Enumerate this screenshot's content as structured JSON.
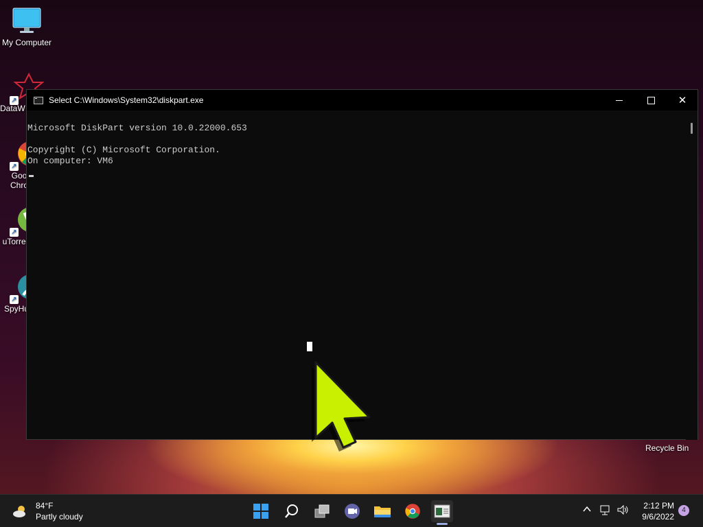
{
  "desktop": {
    "icons": [
      {
        "label": "My Computer"
      },
      {
        "label": "DataW"
      },
      {
        "label": "Goo Chro"
      },
      {
        "label": "uTorren"
      },
      {
        "label": "SpyHu"
      }
    ],
    "recycle_bin": "Recycle Bin"
  },
  "window": {
    "title": "Select C:\\Windows\\System32\\diskpart.exe",
    "console_lines": [
      "Microsoft DiskPart version 10.0.22000.653",
      "",
      "Copyright (C) Microsoft Corporation.",
      "On computer: VM6"
    ]
  },
  "taskbar": {
    "weather_temp": "84°F",
    "weather_desc": "Partly cloudy",
    "time": "2:12 PM",
    "date": "9/6/2022",
    "notification_count": "4"
  },
  "colors": {
    "pointer": "#c8f000",
    "console_bg": "#0c0c0c",
    "console_text": "#cccccc",
    "taskbar_bg": "#1c1c1c"
  }
}
